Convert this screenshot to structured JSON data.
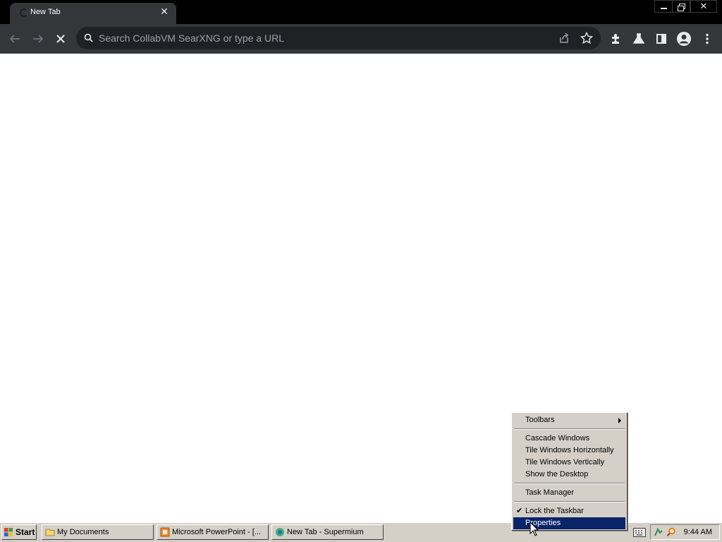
{
  "browser": {
    "tab": {
      "title": "New Tab"
    },
    "omnibox": {
      "placeholder": "Search CollabVM SearXNG or type a URL"
    }
  },
  "context_menu": {
    "items": [
      {
        "label": "Toolbars"
      },
      {
        "label": "Cascade Windows"
      },
      {
        "label": "Tile Windows Horizontally"
      },
      {
        "label": "Tile Windows Vertically"
      },
      {
        "label": "Show the Desktop"
      },
      {
        "label": "Task Manager"
      },
      {
        "label": "Lock the Taskbar"
      },
      {
        "label": "Properties"
      }
    ]
  },
  "taskbar": {
    "start_label": "Start",
    "buttons": [
      {
        "label": "My Documents"
      },
      {
        "label": "Microsoft PowerPoint - [..."
      },
      {
        "label": "New Tab - Supermium"
      }
    ],
    "clock": "9:44 AM"
  },
  "colors": {
    "menu_highlight": "#0a246a",
    "taskbar": "#d4d0c8",
    "browser_frame": "#35363a"
  }
}
